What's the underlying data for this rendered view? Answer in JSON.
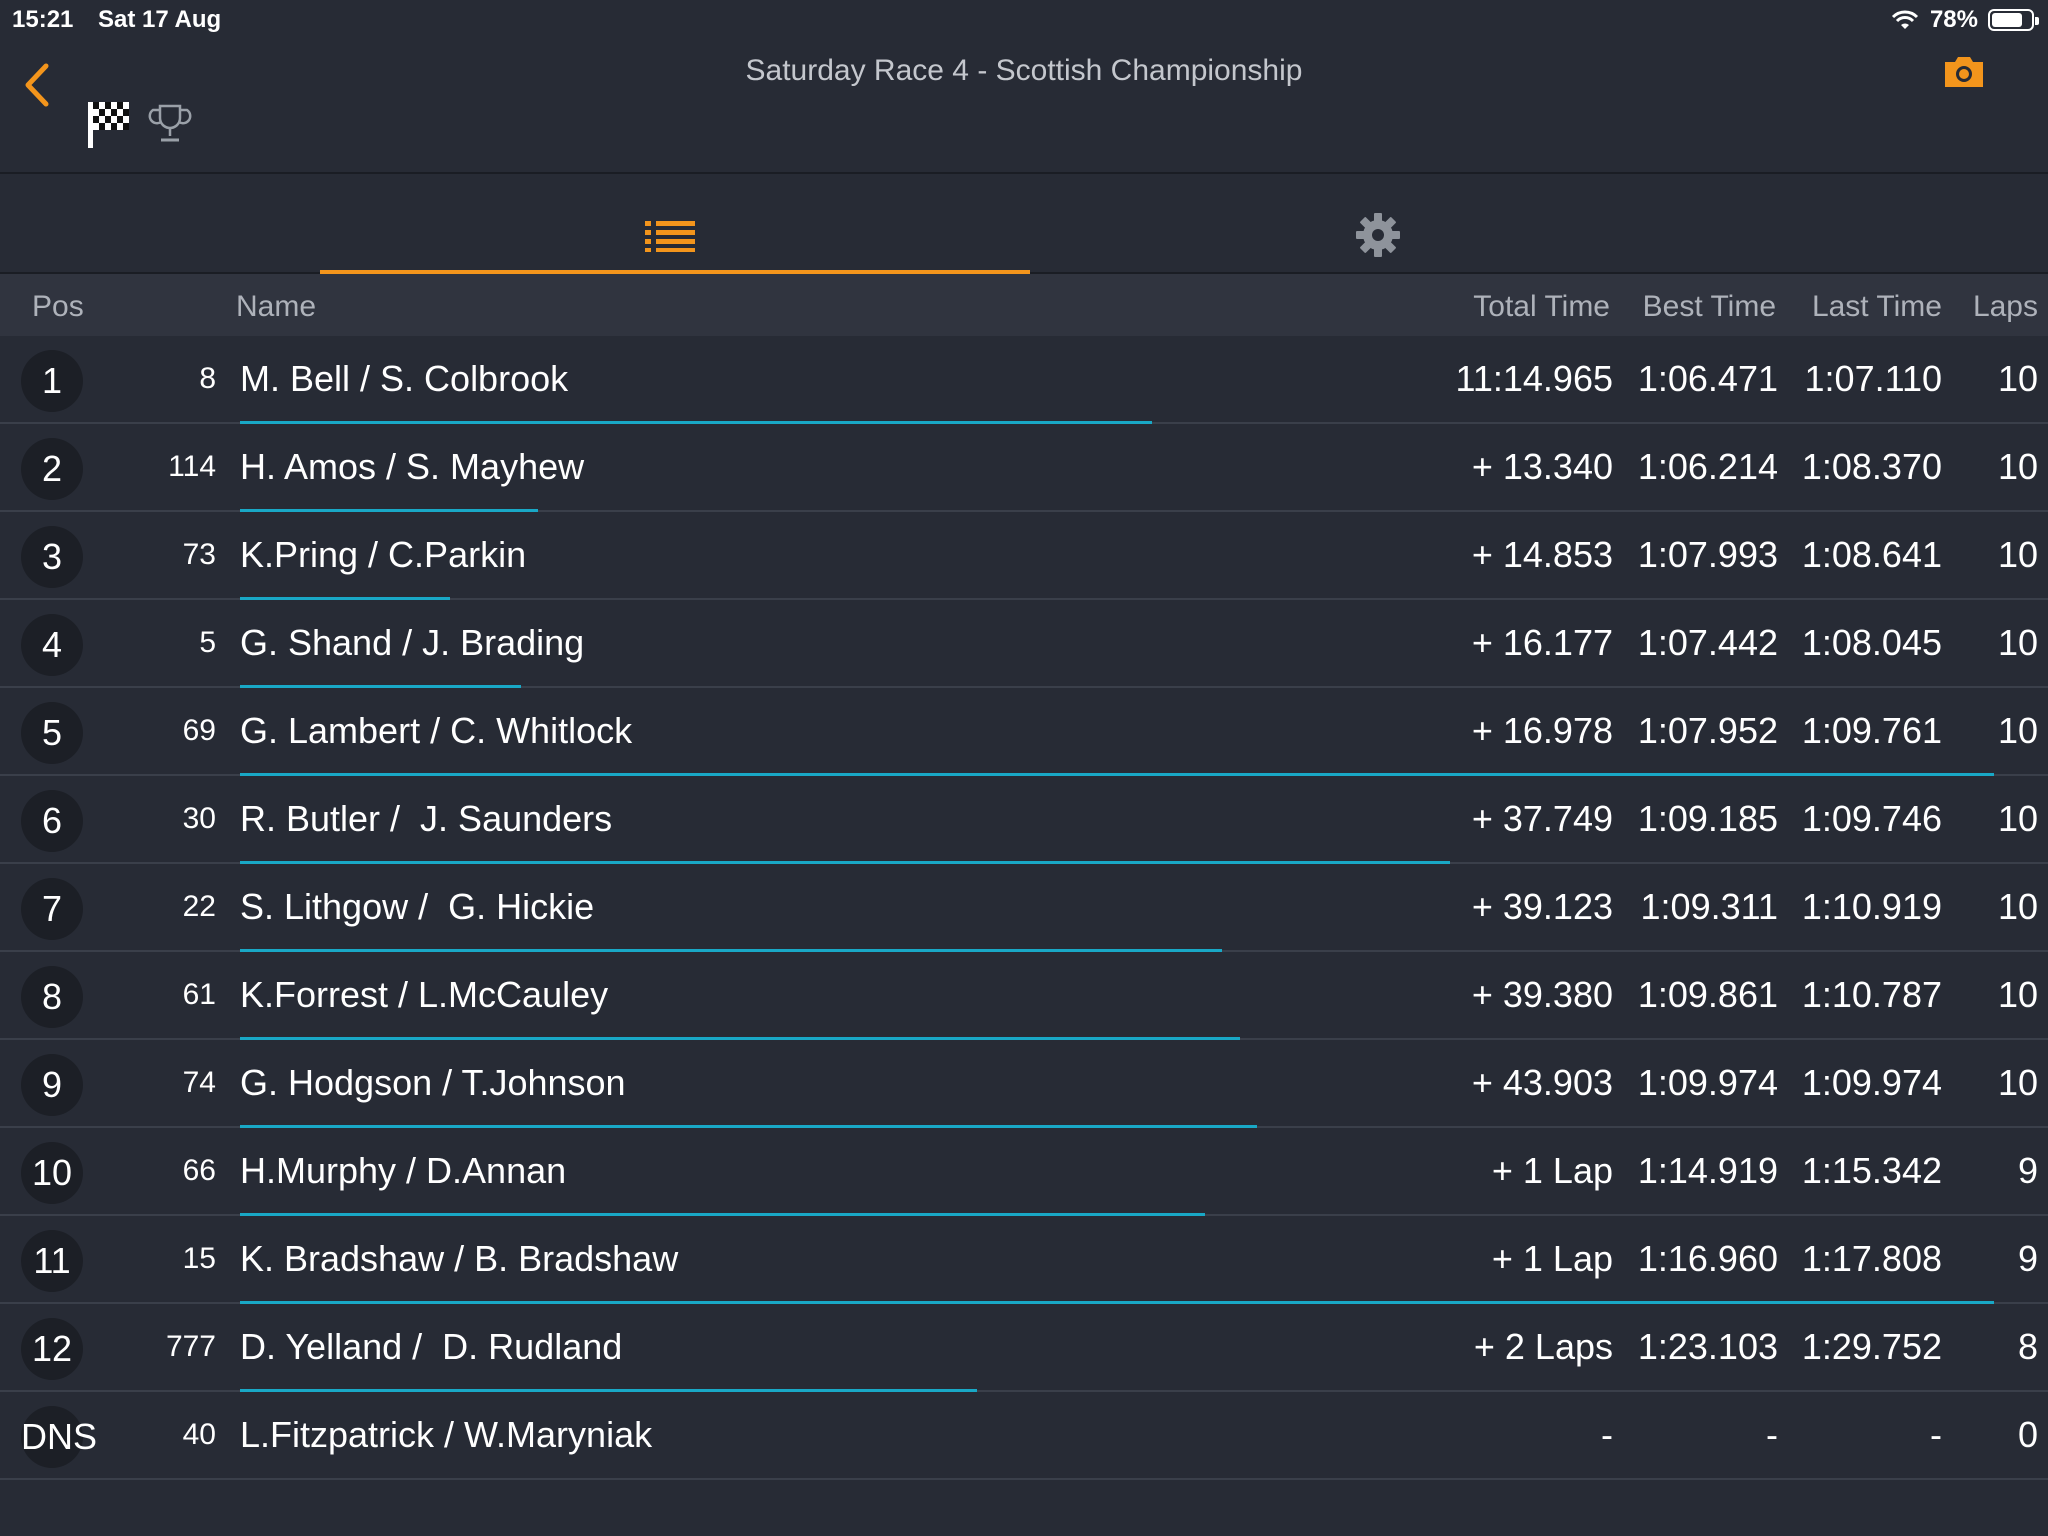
{
  "status_bar": {
    "time": "15:21",
    "date": "Sat 17 Aug",
    "battery": "78%",
    "battery_level": 0.78
  },
  "header": {
    "title": "Saturday Race 4 - Scottish Championship",
    "icons": [
      "chevron-left-icon",
      "chequered-flag-icon",
      "trophy-icon",
      "camera-icon"
    ]
  },
  "tabs": [
    {
      "icon": "list-icon",
      "active": true
    },
    {
      "icon": "gear-icon",
      "active": false
    }
  ],
  "accent_color": "#f3951c",
  "progress_color": "#19a8c6",
  "columns": {
    "pos": "Pos",
    "name": "Name",
    "total": "Total Time",
    "best": "Best Time",
    "last": "Last Time",
    "laps": "Laps"
  },
  "rows": [
    {
      "pos": "1",
      "num": "8",
      "name": "M. Bell / S. Colbrook",
      "total": "11:14.965",
      "best": "1:06.471",
      "last": "1:07.110",
      "laps": "10",
      "progress": 0.52
    },
    {
      "pos": "2",
      "num": "114",
      "name": "H. Amos / S. Mayhew",
      "total": "+ 13.340",
      "best": "1:06.214",
      "last": "1:08.370",
      "laps": "10",
      "progress": 0.17
    },
    {
      "pos": "3",
      "num": "73",
      "name": "K.Pring / C.Parkin",
      "total": "+ 14.853",
      "best": "1:07.993",
      "last": "1:08.641",
      "laps": "10",
      "progress": 0.12
    },
    {
      "pos": "4",
      "num": "5",
      "name": "G. Shand / J. Brading",
      "total": "+ 16.177",
      "best": "1:07.442",
      "last": "1:08.045",
      "laps": "10",
      "progress": 0.16
    },
    {
      "pos": "5",
      "num": "69",
      "name": "G. Lambert / C. Whitlock",
      "total": "+ 16.978",
      "best": "1:07.952",
      "last": "1:09.761",
      "laps": "10",
      "progress": 1.0
    },
    {
      "pos": "6",
      "num": "30",
      "name": "R. Butler /  J. Saunders",
      "total": "+ 37.749",
      "best": "1:09.185",
      "last": "1:09.746",
      "laps": "10",
      "progress": 0.69
    },
    {
      "pos": "7",
      "num": "22",
      "name": "S. Lithgow /  G. Hickie",
      "total": "+ 39.123",
      "best": "1:09.311",
      "last": "1:10.919",
      "laps": "10",
      "progress": 0.56
    },
    {
      "pos": "8",
      "num": "61",
      "name": "K.Forrest / L.McCauley",
      "total": "+ 39.380",
      "best": "1:09.861",
      "last": "1:10.787",
      "laps": "10",
      "progress": 0.57
    },
    {
      "pos": "9",
      "num": "74",
      "name": "G. Hodgson / T.Johnson",
      "total": "+ 43.903",
      "best": "1:09.974",
      "last": "1:09.974",
      "laps": "10",
      "progress": 0.58
    },
    {
      "pos": "10",
      "num": "66",
      "name": "H.Murphy / D.Annan",
      "total": "+ 1 Lap",
      "best": "1:14.919",
      "last": "1:15.342",
      "laps": "9",
      "progress": 0.55
    },
    {
      "pos": "11",
      "num": "15",
      "name": "K. Bradshaw / B. Bradshaw",
      "total": "+ 1 Lap",
      "best": "1:16.960",
      "last": "1:17.808",
      "laps": "9",
      "progress": 1.0
    },
    {
      "pos": "12",
      "num": "777",
      "name": "D. Yelland /  D. Rudland",
      "total": "+ 2 Laps",
      "best": "1:23.103",
      "last": "1:29.752",
      "laps": "8",
      "progress": 0.42
    },
    {
      "pos": "DNS",
      "num": "40",
      "name": "L.Fitzpatrick / W.Maryniak",
      "total": "-",
      "best": "-",
      "last": "-",
      "laps": "0",
      "progress": 0
    }
  ]
}
